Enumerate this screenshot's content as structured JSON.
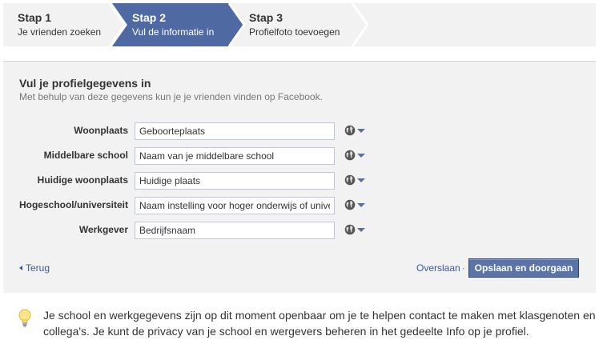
{
  "steps": [
    {
      "num": "Stap 1",
      "desc": "Je vrienden zoeken",
      "active": false
    },
    {
      "num": "Stap 2",
      "desc": "Vul de informatie in",
      "active": true
    },
    {
      "num": "Stap 3",
      "desc": "Profielfoto toevoegen",
      "active": false
    }
  ],
  "form": {
    "title": "Vul je profielgegevens in",
    "subtitle": "Met behulp van deze gegevens kun je je vrienden vinden op Facebook.",
    "fields": [
      {
        "label": "Woonplaats",
        "placeholder": "Geboorteplaats",
        "value": ""
      },
      {
        "label": "Middelbare school",
        "placeholder": "Naam van je middelbare school",
        "value": ""
      },
      {
        "label": "Huidige woonplaats",
        "placeholder": "Huidige plaats",
        "value": ""
      },
      {
        "label": "Hogeschool/universiteit",
        "placeholder": "Naam instelling voor hoger onderwijs of universiteit",
        "value": ""
      },
      {
        "label": "Werkgever",
        "placeholder": "Bedrijfsnaam",
        "value": ""
      }
    ],
    "privacy_icon": "globe-icon"
  },
  "actions": {
    "back_label": "Terug",
    "skip_label": "Overslaan",
    "skip_separator": "·",
    "save_label": "Opslaan en doorgaan"
  },
  "notice": {
    "icon": "lightbulb-icon",
    "text": "Je school en werkgegevens zijn op dit moment openbaar om je te helpen contact te maken met klasgenoten en collega's. Je kunt de privacy van je school en wergevers beheren in het gedeelte Info op je profiel."
  },
  "colors": {
    "active_step": "#4f6aa3",
    "panel_bg": "#f2f2f2",
    "link": "#3b5998",
    "button": "#5b74a8"
  }
}
